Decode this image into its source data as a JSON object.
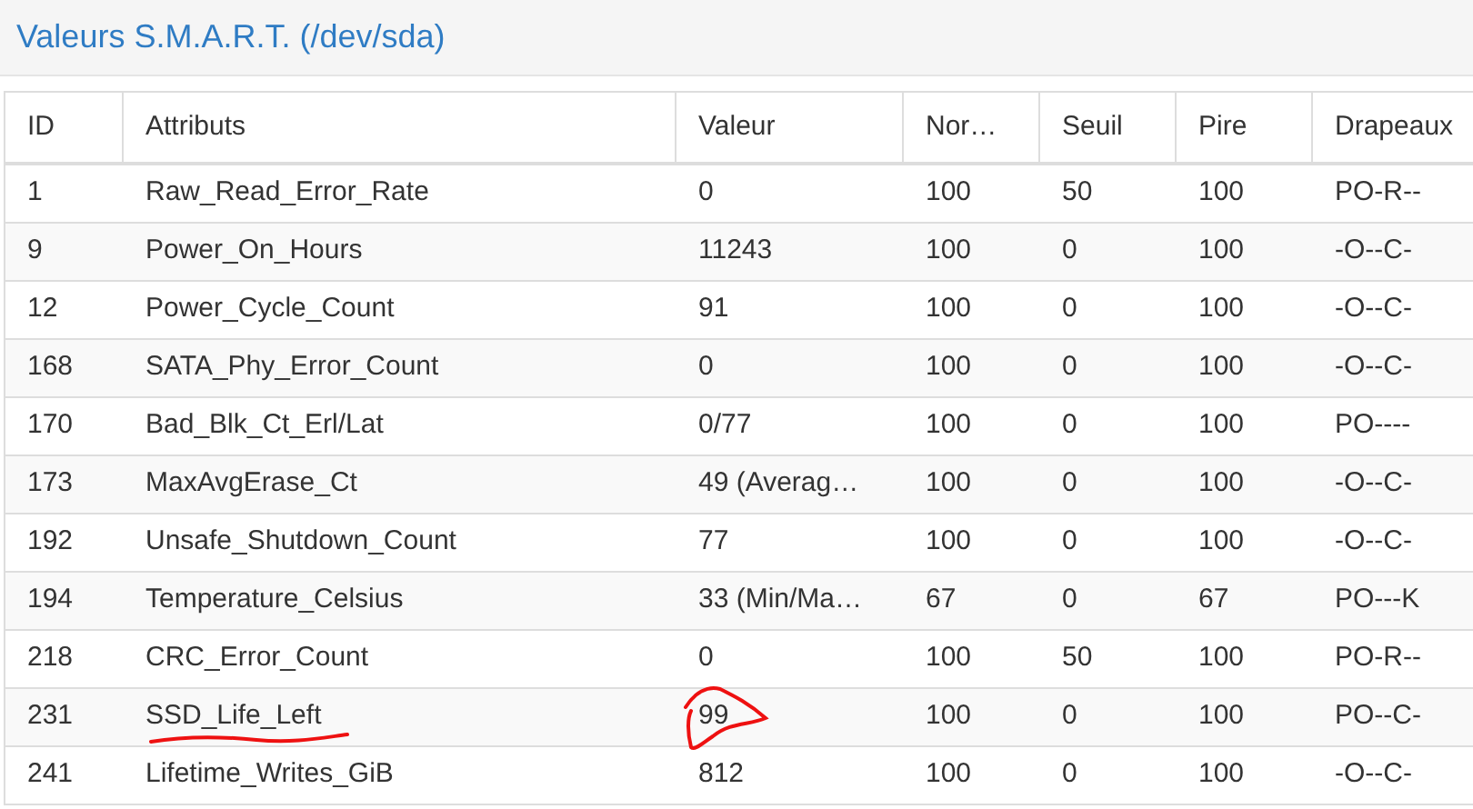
{
  "panel": {
    "title": "Valeurs S.M.A.R.T. (/dev/sda)"
  },
  "table": {
    "columns": [
      "ID",
      "Attributs",
      "Valeur",
      "Nor…",
      "Seuil",
      "Pire",
      "Drapeaux"
    ],
    "rows": [
      {
        "cells": [
          "1",
          "Raw_Read_Error_Rate",
          "0",
          "100",
          "50",
          "100",
          "PO-R--"
        ],
        "marked": false
      },
      {
        "cells": [
          "9",
          "Power_On_Hours",
          "11243",
          "100",
          "0",
          "100",
          "-O--C-"
        ],
        "marked": false
      },
      {
        "cells": [
          "12",
          "Power_Cycle_Count",
          "91",
          "100",
          "0",
          "100",
          "-O--C-"
        ],
        "marked": false
      },
      {
        "cells": [
          "168",
          "SATA_Phy_Error_Count",
          "0",
          "100",
          "0",
          "100",
          "-O--C-"
        ],
        "marked": false
      },
      {
        "cells": [
          "170",
          "Bad_Blk_Ct_Erl/Lat",
          "0/77",
          "100",
          "0",
          "100",
          "PO----"
        ],
        "marked": false
      },
      {
        "cells": [
          "173",
          "MaxAvgErase_Ct",
          "49 (Averag…",
          "100",
          "0",
          "100",
          "-O--C-"
        ],
        "marked": false
      },
      {
        "cells": [
          "192",
          "Unsafe_Shutdown_Count",
          "77",
          "100",
          "0",
          "100",
          "-O--C-"
        ],
        "marked": false
      },
      {
        "cells": [
          "194",
          "Temperature_Celsius",
          "33 (Min/Ma…",
          "67",
          "0",
          "67",
          "PO---K"
        ],
        "marked": false
      },
      {
        "cells": [
          "218",
          "CRC_Error_Count",
          "0",
          "100",
          "50",
          "100",
          "PO-R--"
        ],
        "marked": false
      },
      {
        "cells": [
          "231",
          "SSD_Life_Left",
          "99",
          "100",
          "0",
          "100",
          "PO--C-"
        ],
        "marked": true
      },
      {
        "cells": [
          "241",
          "Lifetime_Writes_GiB",
          "812",
          "100",
          "0",
          "100",
          "-O--C-"
        ],
        "marked": false
      }
    ]
  }
}
